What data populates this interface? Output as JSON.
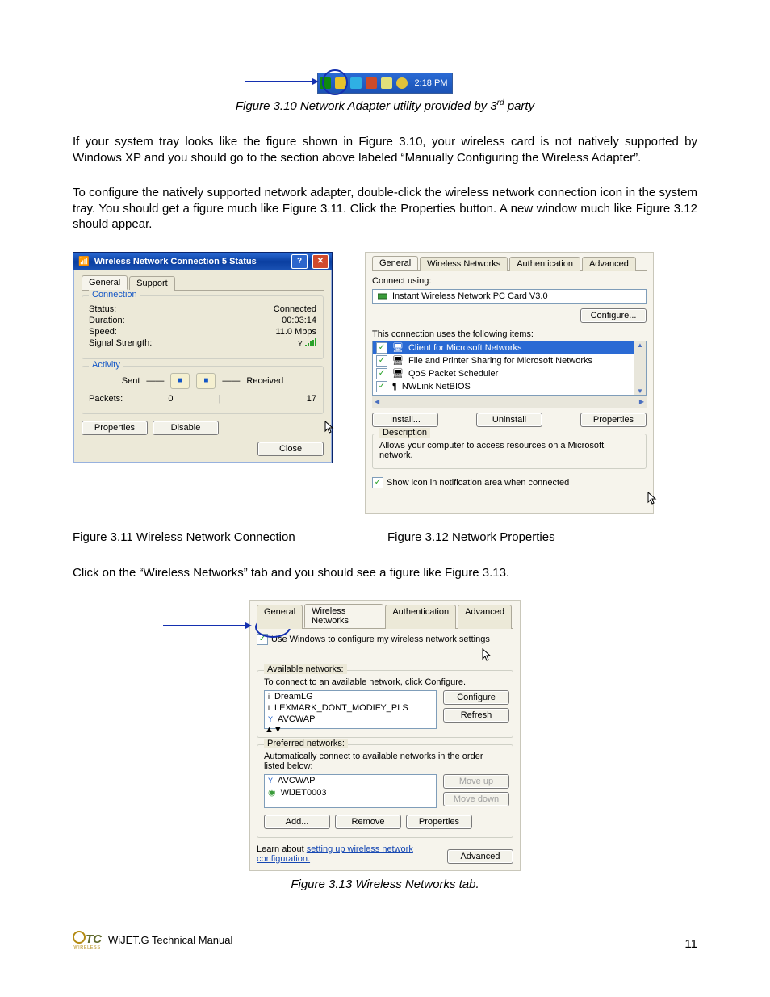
{
  "systray": {
    "time": "2:18 PM"
  },
  "caption310": "Figure 3.10 Network Adapter utility provided by 3",
  "caption310_sup": "rd",
  "caption310_tail": " party",
  "para1": "If your system tray looks like the figure shown in Figure 3.10, your wireless card is not natively supported by Windows XP and you should go to the section above labeled “Manually Configuring the Wireless Adapter”.",
  "para2": "To configure the natively supported network adapter, double-click the wireless network connection icon in the system tray. You should get a figure much like Figure 3.11. Click the Properties button. A new window much like Figure 3.12 should appear.",
  "fig311": {
    "title": "Wireless Network Connection 5 Status",
    "tabs": {
      "general": "General",
      "support": "Support"
    },
    "connection_legend": "Connection",
    "status_l": "Status:",
    "status_v": "Connected",
    "duration_l": "Duration:",
    "duration_v": "00:03:14",
    "speed_l": "Speed:",
    "speed_v": "11.0 Mbps",
    "signal_l": "Signal Strength:",
    "activity_legend": "Activity",
    "sent": "Sent",
    "received": "Received",
    "packets_l": "Packets:",
    "packets_sent": "0",
    "packets_recv": "17",
    "btn_properties": "Properties",
    "btn_disable": "Disable",
    "btn_close": "Close"
  },
  "fig312": {
    "tabs": {
      "general": "General",
      "wnet": "Wireless Networks",
      "auth": "Authentication",
      "adv": "Advanced"
    },
    "connect_using": "Connect using:",
    "adapter": "Instant Wireless Network PC Card V3.0",
    "btn_configure": "Configure...",
    "uses_items": "This connection uses the following items:",
    "items": [
      "Client for Microsoft Networks",
      "File and Printer Sharing for Microsoft Networks",
      "QoS Packet Scheduler",
      "NWLink NetBIOS"
    ],
    "btn_install": "Install...",
    "btn_uninstall": "Uninstall",
    "btn_properties": "Properties",
    "desc_legend": "Description",
    "desc_text": "Allows your computer to access resources on a Microsoft network.",
    "show_icon": "Show icon in notification area when connected"
  },
  "cap311": "Figure 3.11 Wireless Network Connection",
  "cap312": "Figure 3.12 Network Properties",
  "para3": "Click on the “Wireless Networks” tab and you should see a figure like Figure 3.13.",
  "fig313": {
    "tabs": {
      "general": "General",
      "wnet": "Wireless Networks",
      "auth": "Authentication",
      "adv": "Advanced"
    },
    "use_windows": "Use Windows to configure my wireless network settings",
    "avail_legend": "Available networks:",
    "avail_hint": "To connect to an available network, click Configure.",
    "avail_items": [
      "DreamLG",
      "LEXMARK_DONT_MODIFY_PLS",
      "AVCWAP"
    ],
    "btn_configure": "Configure",
    "btn_refresh": "Refresh",
    "pref_legend": "Preferred networks:",
    "pref_hint": "Automatically connect to available networks in the order listed below:",
    "pref_items": [
      "AVCWAP",
      "WiJET0003"
    ],
    "btn_moveup": "Move up",
    "btn_movedown": "Move down",
    "btn_add": "Add...",
    "btn_remove": "Remove",
    "btn_properties": "Properties",
    "learn_pre": "Learn about ",
    "learn_link": "setting up wireless network configuration.",
    "btn_advanced": "Advanced"
  },
  "cap313": "Figure 3.13 Wireless Networks tab.",
  "footer": {
    "logo_main": "TC",
    "logo_sub": "WIRELESS",
    "manual": "WiJET.G Technical Manual",
    "page": "11"
  }
}
